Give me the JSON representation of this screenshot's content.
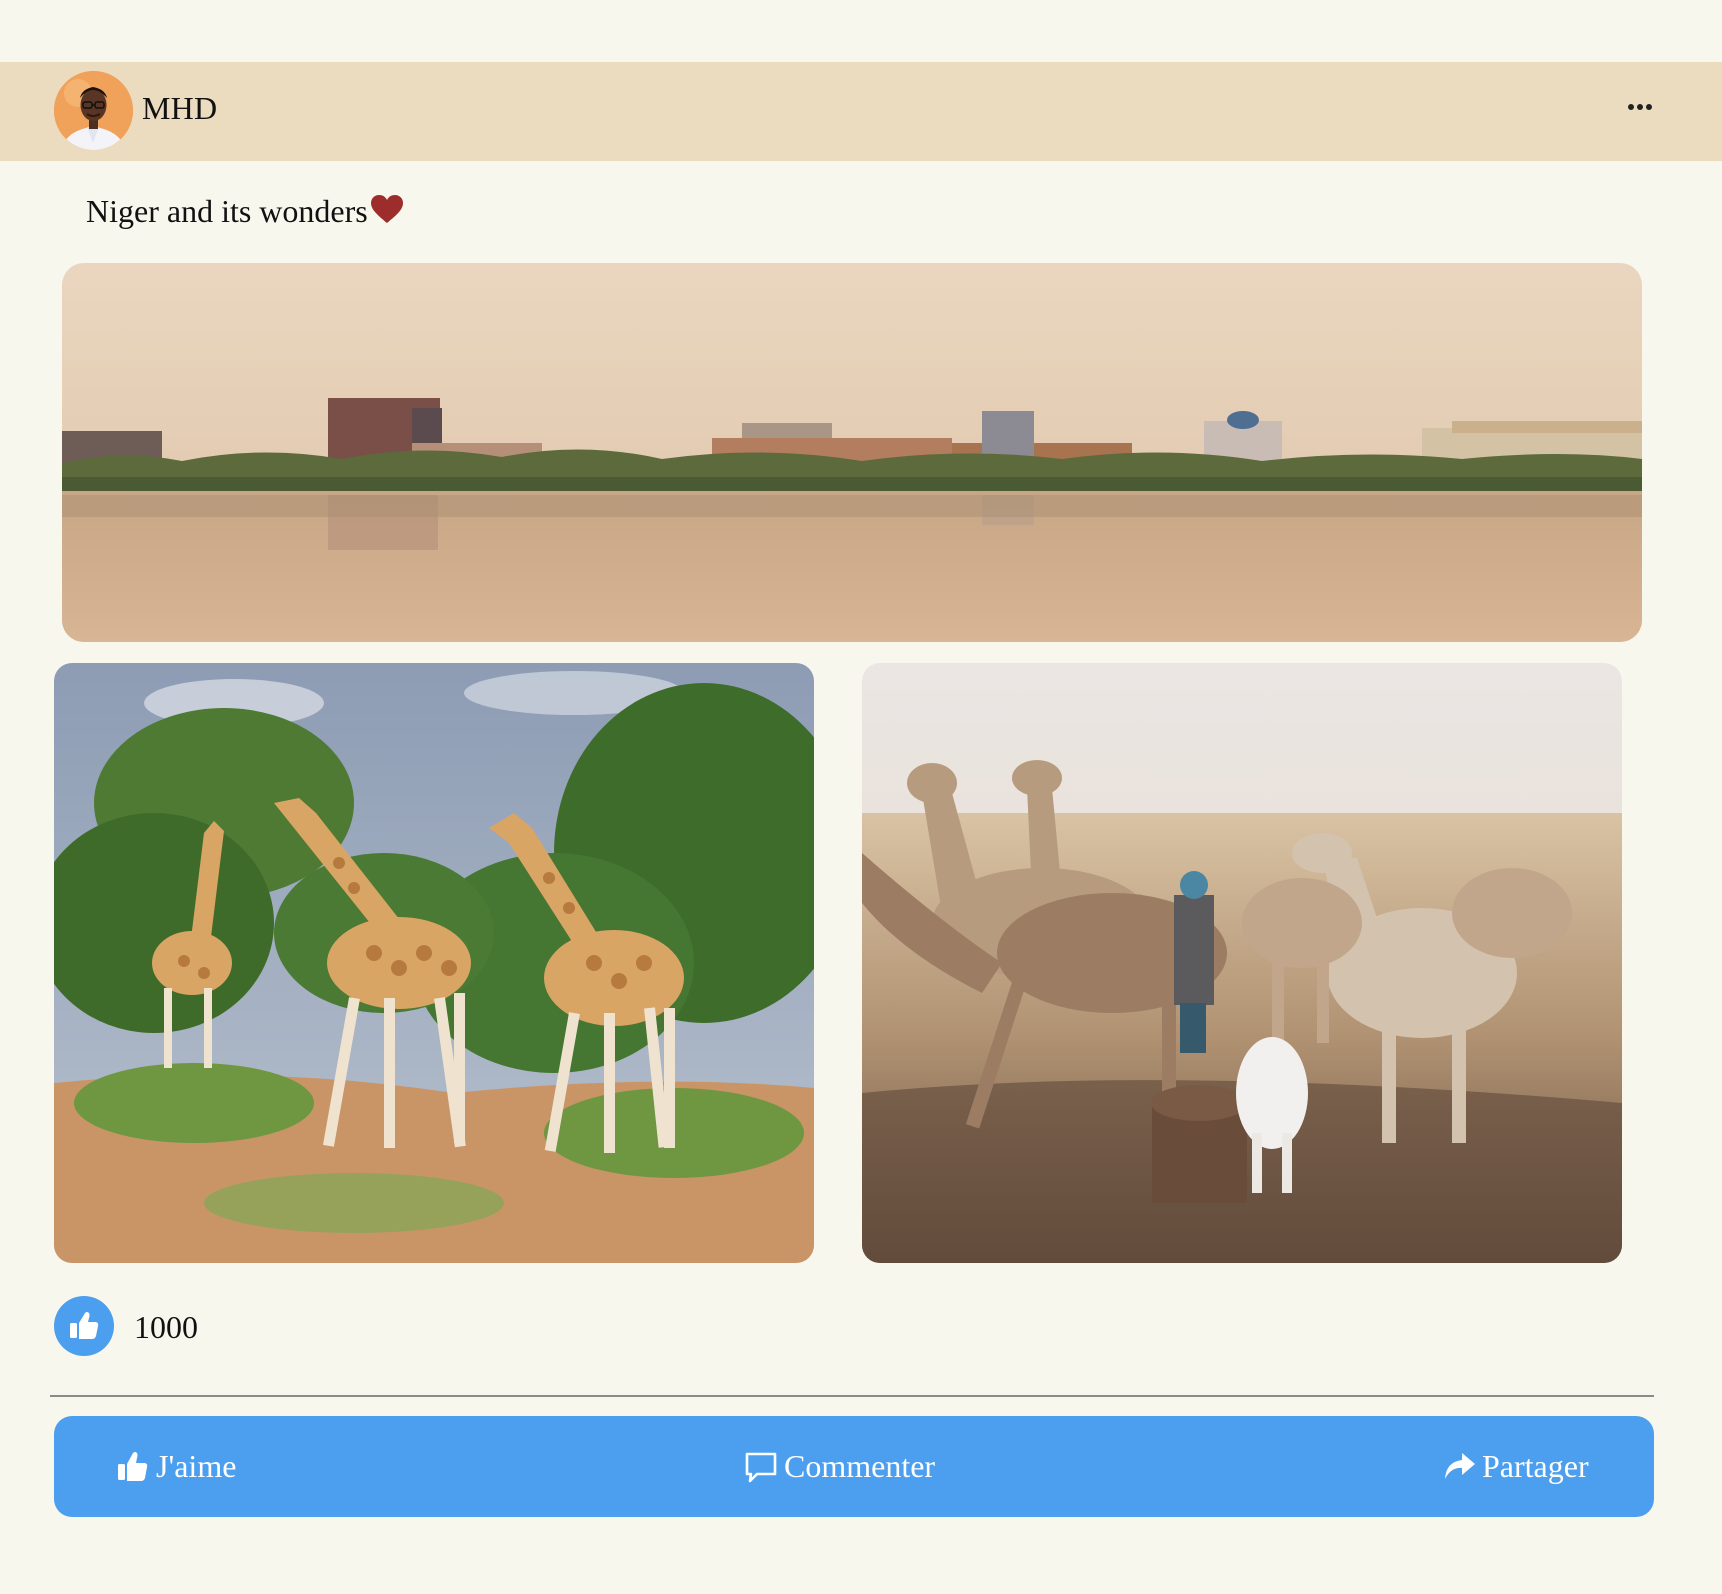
{
  "post": {
    "author": "MHD",
    "avatar_icon": "avatar-photo",
    "caption": "Niger and its wonders",
    "caption_icon": "heart-icon",
    "photos": [
      {
        "name": "niamey-river-skyline",
        "description_icon": "image"
      },
      {
        "name": "giraffes",
        "description_icon": "image"
      },
      {
        "name": "camels-at-well",
        "description_icon": "image"
      }
    ],
    "likes": {
      "count": "1000",
      "icon": "thumbs-up-icon"
    },
    "actions": {
      "like_label": "J'aime",
      "comment_label": "Commenter",
      "share_label": "Partager"
    }
  },
  "colors": {
    "page_background": "#f8f7ee",
    "header_background": "#ecdcbf",
    "action_bar": "#4b9fee",
    "heart": "#9c2d2b"
  }
}
